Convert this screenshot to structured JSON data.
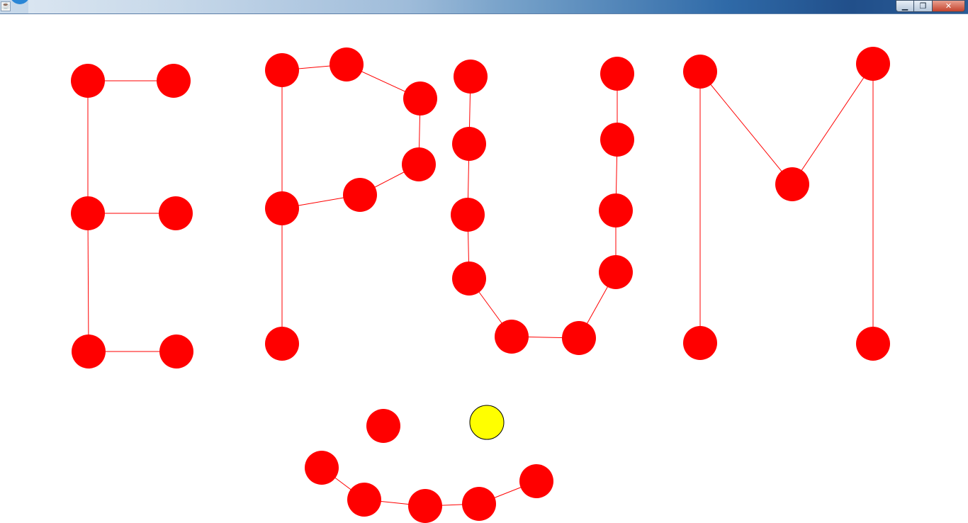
{
  "window": {
    "title": "",
    "buttons": {
      "minimize": "▁",
      "maximize": "❐",
      "close": "✕"
    },
    "colors": {
      "titlebar_start": "#c8d9ea",
      "titlebar_end": "#214f8a"
    }
  },
  "scene": {
    "node_color": "#ff0000",
    "edge_color": "#ff0000",
    "selected_color": "#ffff00",
    "selected_outline": "#000000",
    "description_letters": [
      "E",
      "P",
      "U",
      "M"
    ]
  }
}
